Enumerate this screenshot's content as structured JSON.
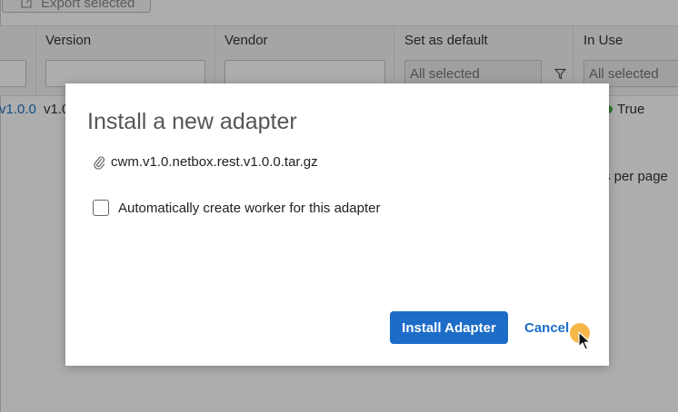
{
  "toolbar": {
    "export_label": "Export selected"
  },
  "table": {
    "columns": [
      {
        "title": "Version"
      },
      {
        "title": "Vendor"
      },
      {
        "title": "Set as default",
        "filter_placeholder": "All selected"
      },
      {
        "title": "In Use",
        "filter_placeholder": "All selected"
      }
    ],
    "row": {
      "name_fragment": "v1.0.0",
      "version_fragment": "v1.0",
      "in_use": "True"
    },
    "pagination_label": "s per page"
  },
  "modal": {
    "title": "Install a new adapter",
    "file_name": "cwm.v1.0.netbox.rest.v1.0.0.tar.gz",
    "checkbox_label": "Automatically create worker for this adapter",
    "primary_button": "Install Adapter",
    "cancel_button": "Cancel"
  },
  "colors": {
    "accent": "#1d6cc8",
    "status_true": "#4caf50",
    "cursor_highlight": "#f5aa28"
  },
  "icons": {
    "export": "export-icon",
    "filter": "funnel-icon",
    "attachment": "paperclip-icon",
    "cursor": "mouse-pointer-icon"
  }
}
